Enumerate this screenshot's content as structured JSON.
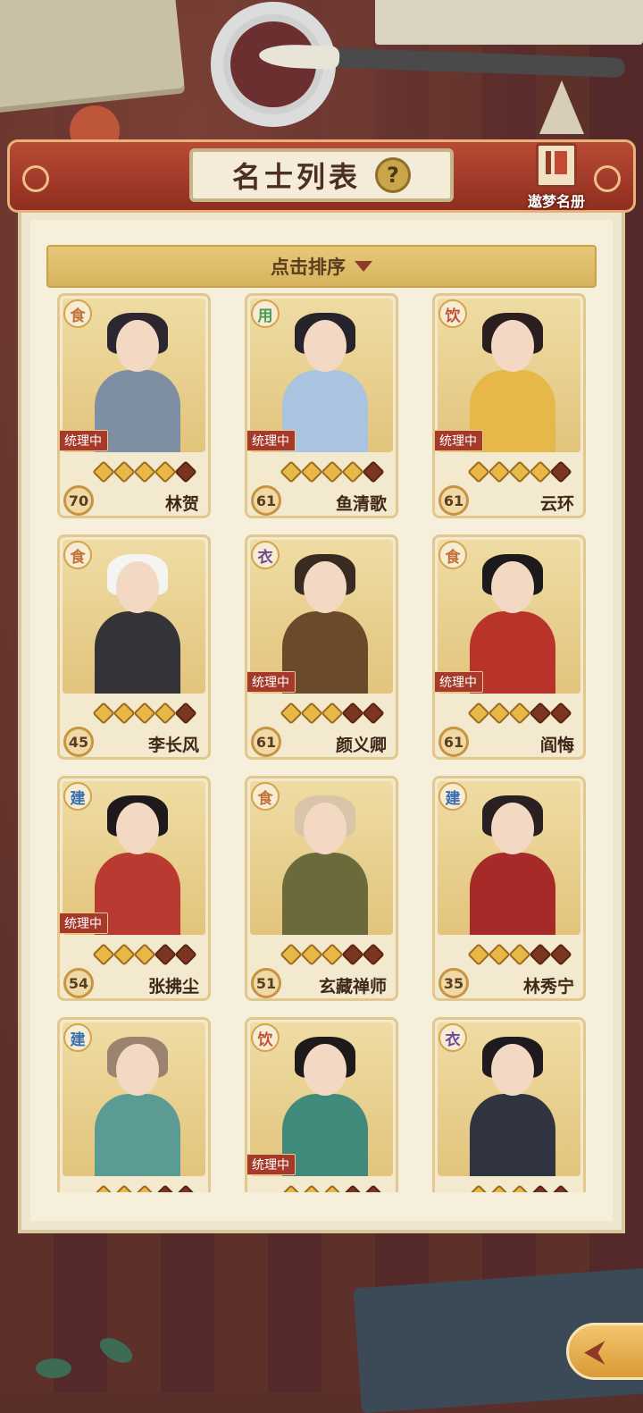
{
  "header": {
    "title": "名士列表",
    "help_icon": "?",
    "dream_register": "遨梦名册"
  },
  "sort": {
    "label": "点击排序"
  },
  "colors": {
    "食": "#c2733a",
    "用": "#4a9a58",
    "饮": "#c4503c",
    "衣": "#6a4a9a",
    "建": "#3a6fb0"
  },
  "cards": [
    {
      "name": "林贺",
      "level": "70",
      "category": "食",
      "status": "统理中",
      "stars": 4,
      "hair": "#2b2630",
      "robe": "#7f8fa3"
    },
    {
      "name": "鱼清歌",
      "level": "61",
      "category": "用",
      "status": "统理中",
      "stars": 4,
      "hair": "#27232a",
      "robe": "#a9c3e0"
    },
    {
      "name": "云环",
      "level": "61",
      "category": "饮",
      "status": "统理中",
      "stars": 4,
      "hair": "#2a1e1e",
      "robe": "#e6b84a"
    },
    {
      "name": "李长风",
      "level": "45",
      "category": "食",
      "status": "",
      "stars": 4,
      "hair": "#f4f4f2",
      "robe": "#333338"
    },
    {
      "name": "颜义卿",
      "level": "61",
      "category": "衣",
      "status": "统理中",
      "stars": 3,
      "hair": "#3a2b22",
      "robe": "#6a4a2a"
    },
    {
      "name": "阎悔",
      "level": "61",
      "category": "食",
      "status": "统理中",
      "stars": 3,
      "hair": "#1d1a1c",
      "robe": "#b8342a"
    },
    {
      "name": "张拂尘",
      "level": "54",
      "category": "建",
      "status": "统理中",
      "stars": 3,
      "hair": "#1e1a1c",
      "robe": "#b93a30"
    },
    {
      "name": "玄藏禅师",
      "level": "51",
      "category": "食",
      "status": "",
      "stars": 3,
      "hair": "#d9c6a8",
      "robe": "#6b6a3a"
    },
    {
      "name": "林秀宁",
      "level": "35",
      "category": "建",
      "status": "",
      "stars": 3,
      "hair": "#2a2022",
      "robe": "#a62a28"
    },
    {
      "name": "",
      "level": "",
      "category": "建",
      "status": "",
      "stars": 3,
      "hair": "#9a8470",
      "robe": "#5c9a94"
    },
    {
      "name": "",
      "level": "",
      "category": "饮",
      "status": "统理中",
      "stars": 3,
      "hair": "#1e1a1c",
      "robe": "#3f8a7a"
    },
    {
      "name": "",
      "level": "",
      "category": "衣",
      "status": "",
      "stars": 3,
      "hair": "#1e1a1e",
      "robe": "#2f3440"
    }
  ],
  "return_icon": "return-icon"
}
